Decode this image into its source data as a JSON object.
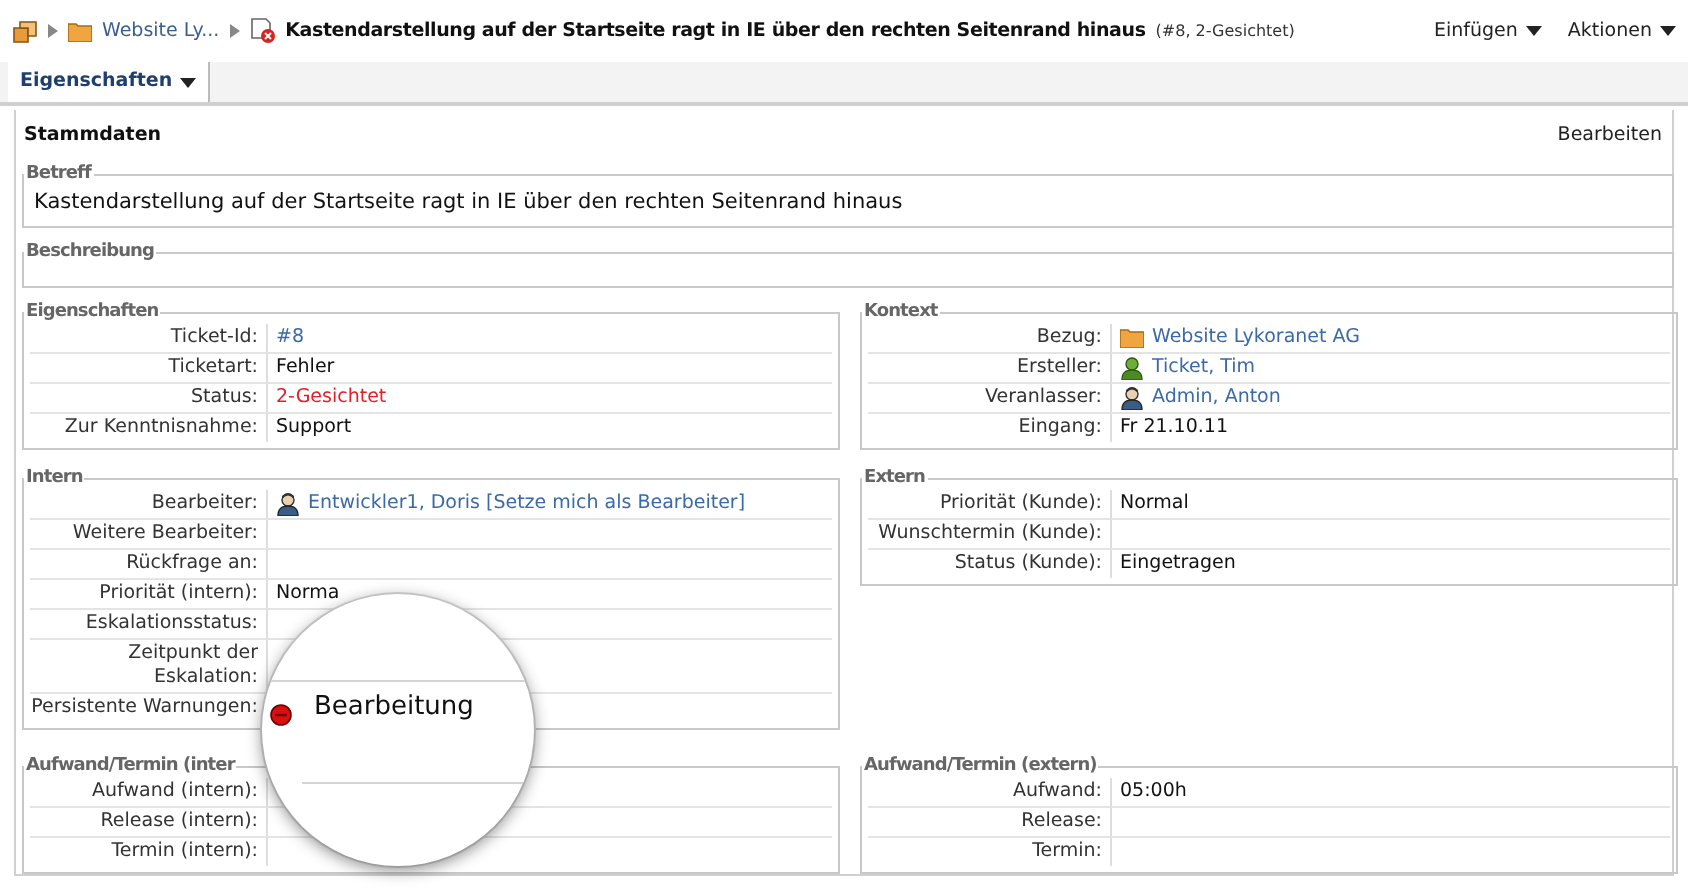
{
  "breadcrumb": [
    {
      "label": "Website Ly..."
    }
  ],
  "ticket": {
    "title": "Kastendarstellung auf der Startseite ragt in IE über den rechten Seitenrand hinaus",
    "meta": "(#8, 2-Gesichtet)"
  },
  "menus": [
    {
      "label": "Einfügen"
    },
    {
      "label": "Aktionen"
    }
  ],
  "tabs": [
    {
      "label": "Eigenschaften",
      "selected": true
    }
  ],
  "panel": {
    "title": "Stammdaten",
    "action": "Bearbeiten"
  },
  "betreff": {
    "title": "Betreff",
    "text": "Kastendarstellung auf der Startseite ragt in IE über den rechten Seitenrand hinaus"
  },
  "beschreibung": {
    "title": "Beschreibung"
  },
  "groups": [
    {
      "title": "Eigenschaften",
      "rows": [
        {
          "label": "Ticket-Id:",
          "value": "#8",
          "kind": "link"
        },
        {
          "label": "Ticketart:",
          "value": "Fehler",
          "kind": "text"
        },
        {
          "label": "Status:",
          "value": "2-Gesichtet",
          "kind": "alert"
        },
        {
          "label": "Zur Kenntnisnahme:",
          "value": "Support",
          "kind": "text"
        }
      ]
    },
    {
      "title": "Kontext",
      "rows": [
        {
          "label": "Bezug:",
          "value": "Website Lykoranet AG",
          "kind": "folder"
        },
        {
          "label": "Ersteller:",
          "value": "Ticket, Tim",
          "kind": "creator"
        },
        {
          "label": "Veranlasser:",
          "value": "Admin, Anton",
          "kind": "person"
        },
        {
          "label": "Eingang:",
          "value": "Fr 21.10.11",
          "kind": "text"
        }
      ]
    },
    {
      "title": "Intern",
      "rows": [
        {
          "label": "Bearbeiter:",
          "value": "Entwickler1, Doris [Setze mich als Bearbeiter]",
          "kind": "person"
        },
        {
          "label": "Weitere Bearbeiter:"
        },
        {
          "label": "Rückfrage an:"
        },
        {
          "label": "Priorität (intern):",
          "value": "Norma",
          "kind": "text"
        },
        {
          "label": "Eskalationsstatus:"
        },
        {
          "label": "Zeitpunkt der Eskalation:"
        },
        {
          "label": "Persistente Warnungen:"
        }
      ]
    },
    {
      "title": "Extern",
      "rows": [
        {
          "label": "Priorität (Kunde):",
          "value": "Normal",
          "kind": "text"
        },
        {
          "label": "Wunschtermin (Kunde):"
        },
        {
          "label": "Status (Kunde):",
          "value": "Eingetragen",
          "kind": "text"
        }
      ]
    },
    {
      "title": "Aufwand/Termin (inter",
      "rows": [
        {
          "label": "Aufwand (intern):"
        },
        {
          "label": "Release (intern):"
        },
        {
          "label": "Termin (intern):"
        }
      ]
    },
    {
      "title": "Aufwand/Termin (extern)",
      "rows": [
        {
          "label": "Aufwand:",
          "value": "05:00h",
          "kind": "text"
        },
        {
          "label": "Release:"
        },
        {
          "label": "Termin:"
        }
      ]
    }
  ],
  "magnifier": {
    "value": "Bearbeitung"
  }
}
